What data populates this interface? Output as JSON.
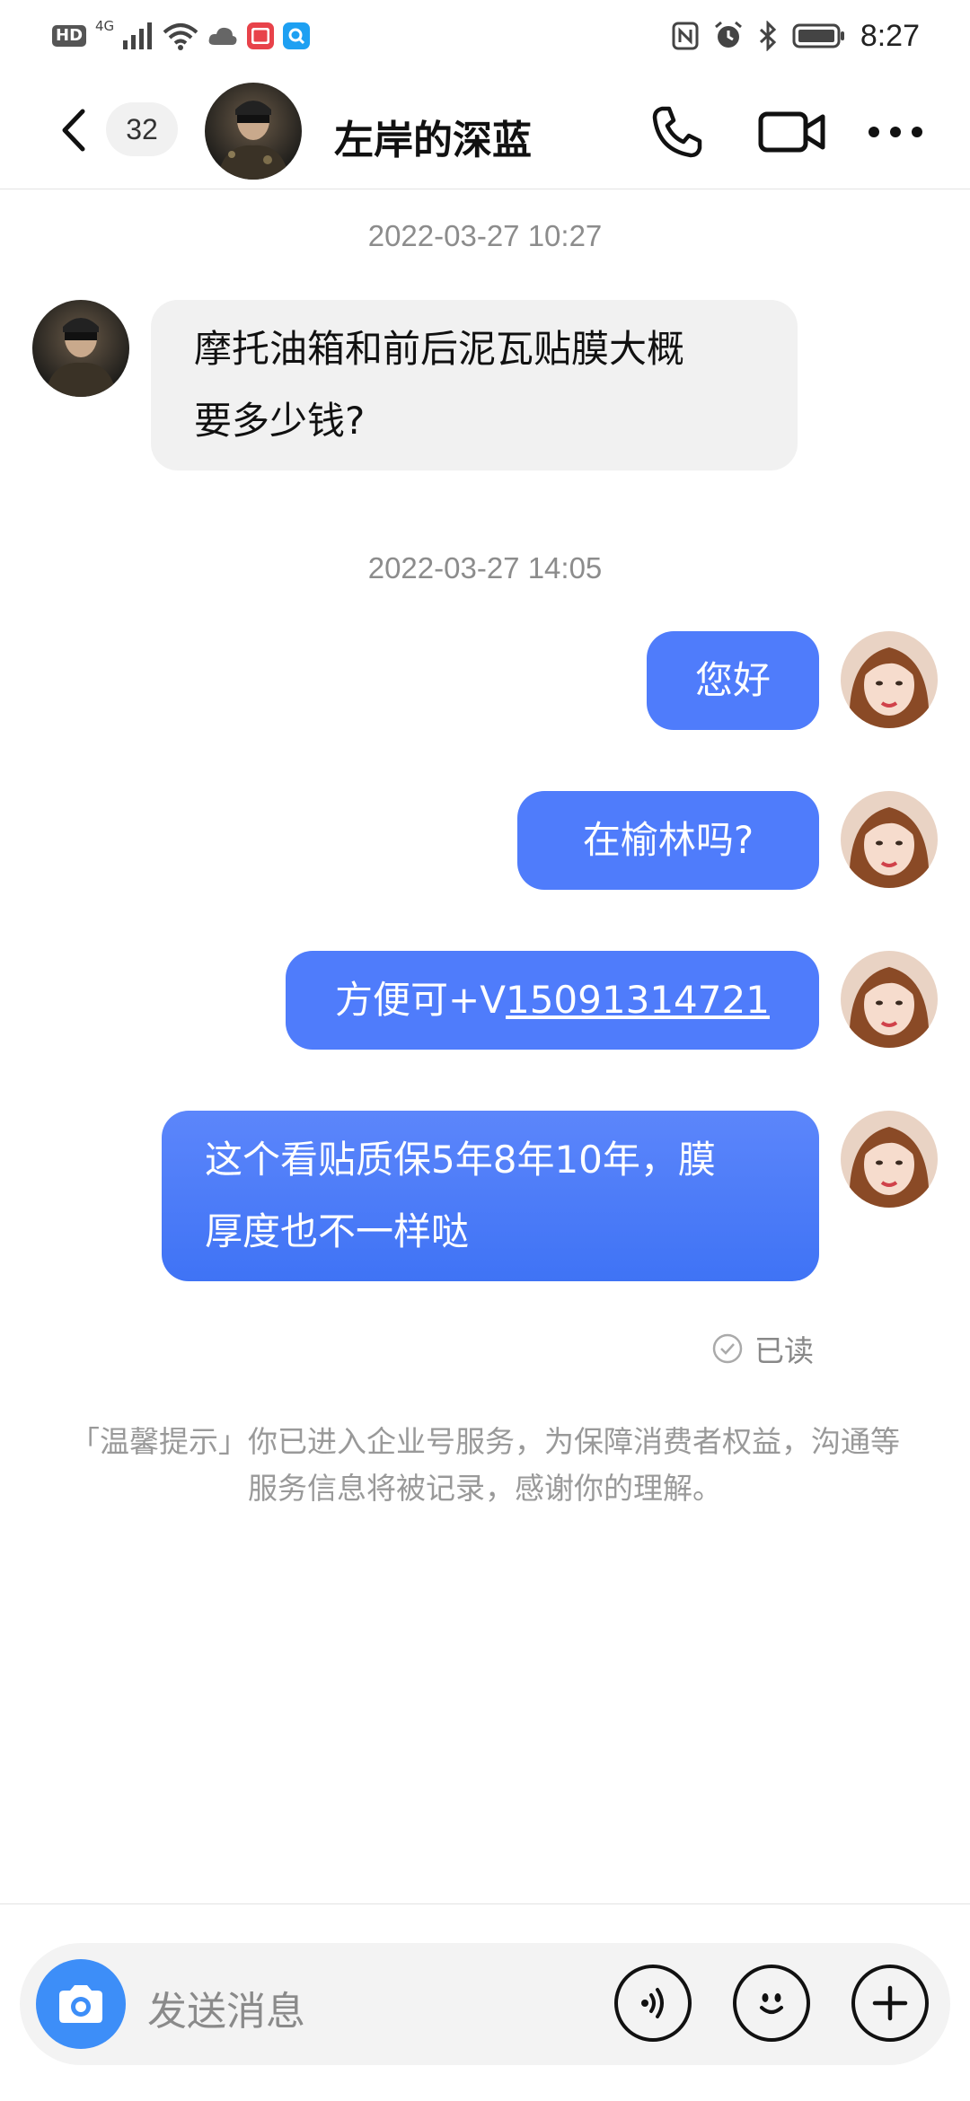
{
  "status_bar": {
    "hd": "HD",
    "network": "4G",
    "time": "8:27",
    "icons": [
      "signal-icon",
      "wifi-icon",
      "cloud-icon",
      "red-app-icon",
      "blue-app-icon",
      "nfc-icon",
      "alarm-icon",
      "bluetooth-icon",
      "battery-icon"
    ]
  },
  "header": {
    "unread_count": "32",
    "title": "左岸的深蓝",
    "icons": [
      "back-arrow-icon",
      "phone-icon",
      "video-camera-icon",
      "more-dots-icon"
    ]
  },
  "messages": [
    {
      "type": "timestamp",
      "text": "2022-03-27 10:27"
    },
    {
      "type": "incoming",
      "lines": [
        "摩托油箱和前后泥瓦贴膜大概",
        "要多少钱?"
      ]
    },
    {
      "type": "timestamp",
      "text": "2022-03-27 14:05"
    },
    {
      "type": "outgoing",
      "text": "您好"
    },
    {
      "type": "outgoing",
      "text": "在榆林吗?"
    },
    {
      "type": "outgoing",
      "prefix": "方便可+V",
      "link": "15091314721"
    },
    {
      "type": "outgoing",
      "lines": [
        "这个看贴质保5年8年10年，膜",
        "厚度也不一样哒"
      ]
    }
  ],
  "read_status": "已读",
  "notice": {
    "line1": "「温馨提示」你已进入企业号服务，为保障消费者权益，沟通等",
    "line2": "服务信息将被记录，感谢你的理解。"
  },
  "input": {
    "placeholder": "发送消息",
    "icons": [
      "camera-icon",
      "voice-icon",
      "emoji-icon",
      "plus-icon"
    ]
  },
  "colors": {
    "bubble_out": "#4f7cfb",
    "bubble_in": "#f1f1f1",
    "camera_button": "#3d8ef8"
  }
}
